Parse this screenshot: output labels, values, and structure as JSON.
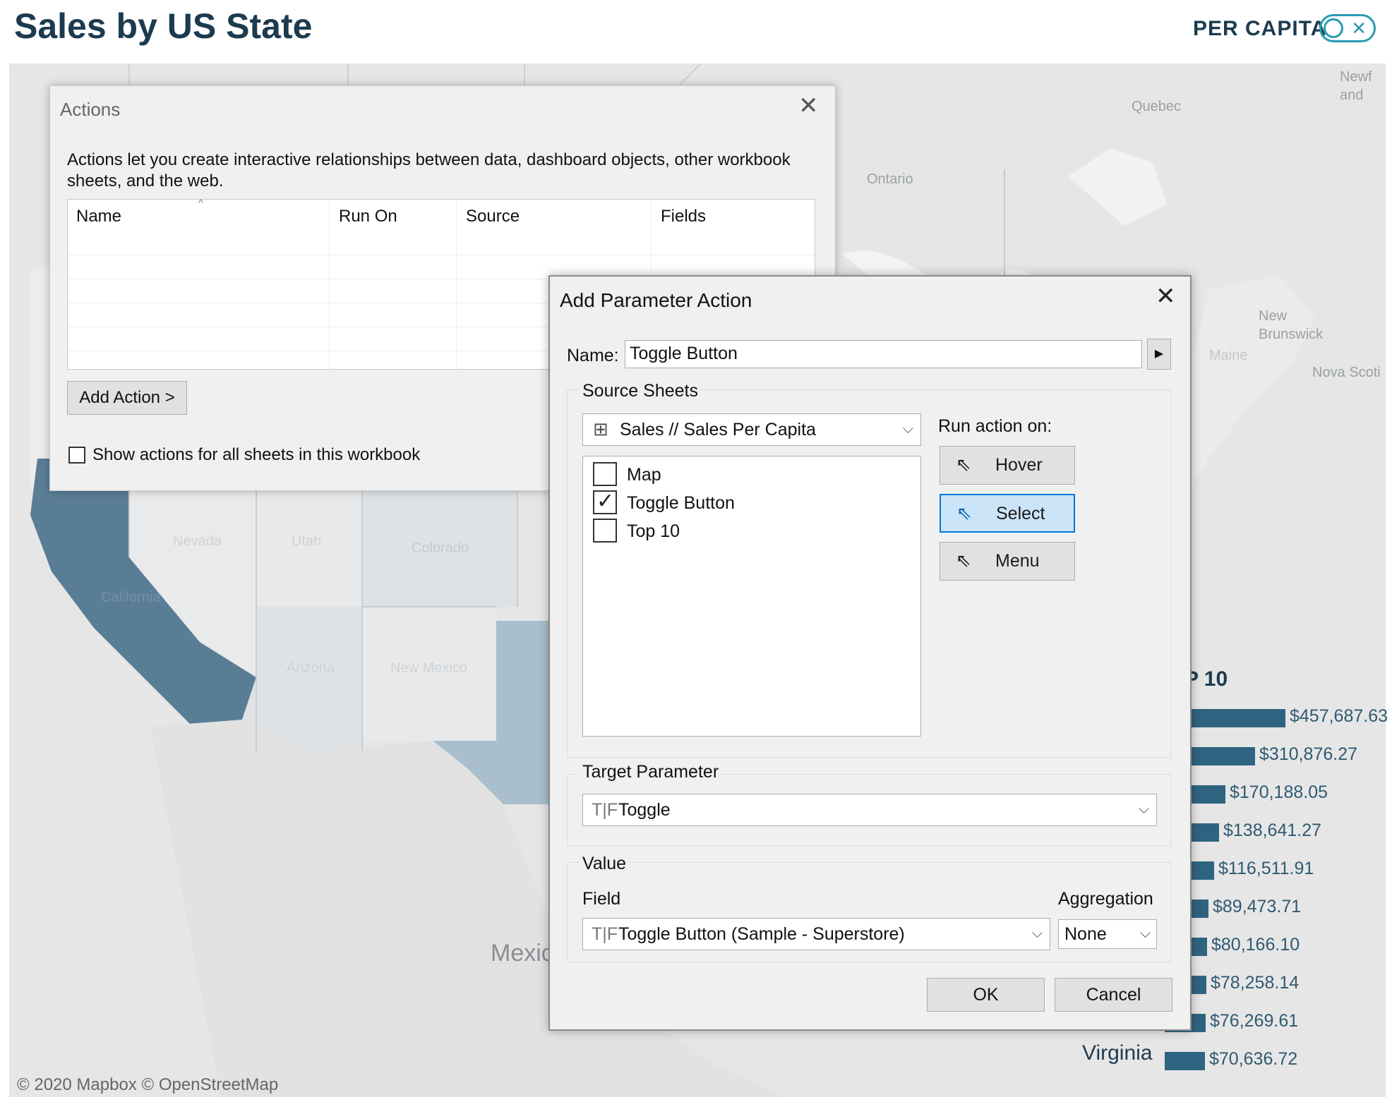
{
  "header": {
    "title": "Sales by US State",
    "toggle_label": "PER CAPITA",
    "toggle_icon": "x-icon"
  },
  "map": {
    "labels": {
      "quebec": "Quebec",
      "ontario": "Ontario",
      "newfoundland": "Newf and",
      "new_brunswick": "New Brunswick",
      "nova_scotia": "Nova Scoti",
      "maine": "Maine",
      "nevada": "Nevada",
      "utah": "Utah",
      "colorado": "Colorado",
      "california": "California",
      "arizona": "Arizona",
      "new_mexico": "New Mexico",
      "mexico": "Mexic"
    },
    "attribution": "© 2020 Mapbox © OpenStreetMap"
  },
  "top10": {
    "title": "P 10",
    "visible_state_label": "Virginia",
    "values": [
      {
        "value": 457687.63,
        "label": "$457,687.63"
      },
      {
        "value": 310876.27,
        "label": "$310,876.27"
      },
      {
        "value": 170188.05,
        "label": "$170,188.05"
      },
      {
        "value": 138641.27,
        "label": "$138,641.27"
      },
      {
        "value": 116511.91,
        "label": "$116,511.91"
      },
      {
        "value": 89473.71,
        "label": "$89,473.71"
      },
      {
        "value": 80166.1,
        "label": "$80,166.10"
      },
      {
        "value": 78258.14,
        "label": "$78,258.14"
      },
      {
        "value": 76269.61,
        "label": "$76,269.61"
      },
      {
        "value": 70636.72,
        "label": "$70,636.72"
      }
    ],
    "bar_color": "#2f6480"
  },
  "actions_dialog": {
    "title": "Actions",
    "description": "Actions let you create interactive relationships between data, dashboard objects, other workbook sheets, and the web.",
    "columns": [
      "Name",
      "Run On",
      "Source",
      "Fields"
    ],
    "add_action_label": "Add Action >",
    "show_all_label": "Show actions for all sheets in this workbook",
    "show_all_checked": false
  },
  "param_dialog": {
    "title": "Add Parameter Action",
    "name_label": "Name:",
    "name_value": "Toggle Button",
    "source_sheets_label": "Source Sheets",
    "source_select_value": "Sales // Sales Per Capita",
    "sheets": [
      {
        "label": "Map",
        "checked": false
      },
      {
        "label": "Toggle Button",
        "checked": true
      },
      {
        "label": "Top 10",
        "checked": false
      }
    ],
    "run_action_label": "Run action on:",
    "run_options": [
      "Hover",
      "Select",
      "Menu"
    ],
    "run_selected": "Select",
    "target_parameter_label": "Target Parameter",
    "target_parameter_type": "T|F",
    "target_parameter_value": "Toggle",
    "value_label": "Value",
    "field_label": "Field",
    "field_type": "T|F",
    "field_value": "Toggle Button (Sample - Superstore)",
    "aggregation_label": "Aggregation",
    "aggregation_value": "None",
    "ok_label": "OK",
    "cancel_label": "Cancel"
  },
  "colors": {
    "title": "#1d3b4f",
    "accent": "#2a9bb4",
    "california": "#5a7d96",
    "texas": "#a9bfcd",
    "select_highlight": "#cce4f7"
  }
}
